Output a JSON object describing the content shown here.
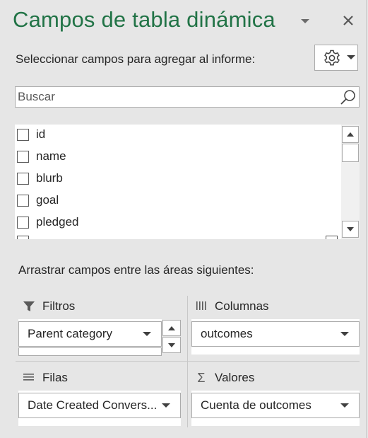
{
  "pane": {
    "title": "Campos de tabla dinámica",
    "choose_fields_label": "Seleccionar campos para agregar al informe:",
    "accent_color": "#217346"
  },
  "search": {
    "placeholder": "Buscar",
    "value": ""
  },
  "fields": [
    {
      "label": "id",
      "checked": false
    },
    {
      "label": "name",
      "checked": false
    },
    {
      "label": "blurb",
      "checked": false
    },
    {
      "label": "goal",
      "checked": false
    },
    {
      "label": "pledged",
      "checked": false
    }
  ],
  "areas": {
    "drag_label": "Arrastrar campos entre las áreas siguientes:",
    "filters": {
      "label": "Filtros",
      "icon": "filter-icon",
      "items": [
        "Parent category"
      ]
    },
    "columns": {
      "label": "Columnas",
      "icon": "columns-icon",
      "items": [
        "outcomes"
      ]
    },
    "rows": {
      "label": "Filas",
      "icon": "rows-icon",
      "items": [
        "Date Created Convers..."
      ]
    },
    "values": {
      "label": "Valores",
      "icon": "sigma-icon",
      "symbol": "Σ",
      "items": [
        "Cuenta de outcomes"
      ]
    }
  },
  "icons": {
    "title_menu": "chevron-down-icon",
    "close": "close-icon",
    "settings": "gear-icon",
    "search": "search-icon"
  }
}
